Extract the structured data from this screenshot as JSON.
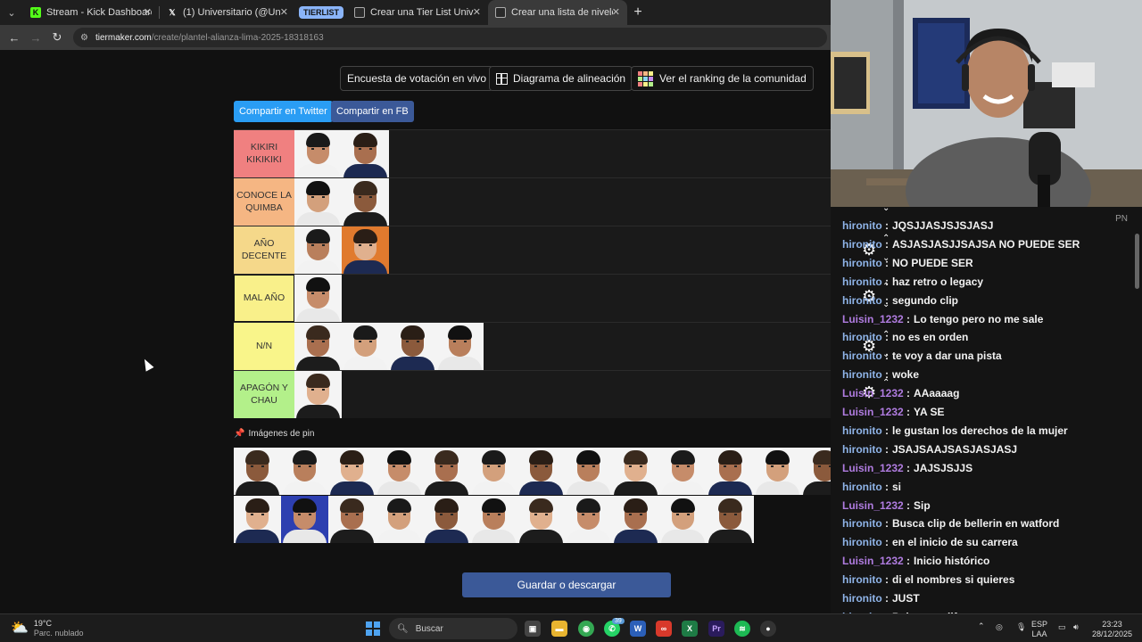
{
  "browser": {
    "tabs": [
      {
        "label": "Stream - Kick Dashboard",
        "favicon": "kick-logo-icon",
        "active": false
      },
      {
        "label": "(1) Universitario (@Universitario",
        "favicon": "x-logo-icon",
        "active": false
      },
      {
        "label": "Crear una Tier List Universitario",
        "favicon": "tiermaker-icon",
        "active": false
      },
      {
        "label": "Crear una lista de niveles de Al",
        "favicon": "tiermaker-icon",
        "active": true
      }
    ],
    "tab_group_label": "TIERLIST",
    "url_host": "tiermaker.com",
    "url_path": "/create/plantel-alianza-lima-2025-18318163"
  },
  "page": {
    "buttons": {
      "live_poll": "Encuesta de votación en vivo",
      "lineup": "Diagrama de alineación",
      "community": "Ver el ranking de la comunidad",
      "twitter": "Compartir en Twitter",
      "facebook": "Compartir en FB",
      "save": "Guardar o descargar"
    },
    "tiers": [
      {
        "label": "KIKIRI KIKIKIKI",
        "color": "#f08080",
        "players": 2
      },
      {
        "label": "CONOCE LA QUIMBA",
        "color": "#f5b683",
        "players": 2
      },
      {
        "label": "AÑO DECENTE",
        "color": "#f5d88a",
        "players": 2
      },
      {
        "label": "MAL AÑO",
        "color": "#f9f08a",
        "players": 1
      },
      {
        "label": "N/N",
        "color": "#f9f58a",
        "players": 4
      },
      {
        "label": "APAGÓN Y CHAU",
        "color": "#b3f08a",
        "players": 1
      }
    ],
    "pinned_title": "Imágenes de pin",
    "pool_players": 25
  },
  "chat": {
    "pn_label": "PN",
    "messages": [
      {
        "user": "hironito",
        "text": "JQSJJASJSJSJASJ",
        "color": "#8fb4e8"
      },
      {
        "user": "hironito",
        "text": "ASJASJASJJSAJSA NO PUEDE SER",
        "color": "#8fb4e8"
      },
      {
        "user": "hironito",
        "text": "NO PUEDE SER",
        "color": "#8fb4e8"
      },
      {
        "user": "hironito",
        "text": "haz retro o legacy",
        "color": "#8fb4e8"
      },
      {
        "user": "hironito",
        "text": "segundo clip",
        "color": "#8fb4e8"
      },
      {
        "user": "Luisin_1232",
        "text": "Lo tengo pero no me sale",
        "color": "#b07ce0"
      },
      {
        "user": "hironito",
        "text": "no es en orden",
        "color": "#8fb4e8"
      },
      {
        "user": "hironito",
        "text": "te voy a dar una pista",
        "color": "#8fb4e8"
      },
      {
        "user": "hironito",
        "text": "woke",
        "color": "#8fb4e8"
      },
      {
        "user": "Luisin_1232",
        "text": "AAaaaag",
        "color": "#b07ce0"
      },
      {
        "user": "Luisin_1232",
        "text": "YA SE",
        "color": "#b07ce0"
      },
      {
        "user": "hironito",
        "text": "le gustan los derechos de la mujer",
        "color": "#8fb4e8"
      },
      {
        "user": "hironito",
        "text": "JSAJSAAJSASJASJASJ",
        "color": "#8fb4e8"
      },
      {
        "user": "Luisin_1232",
        "text": "JAJSJSJJS",
        "color": "#b07ce0"
      },
      {
        "user": "hironito",
        "text": "si",
        "color": "#8fb4e8"
      },
      {
        "user": "Luisin_1232",
        "text": "Sip",
        "color": "#b07ce0"
      },
      {
        "user": "hironito",
        "text": "Busca clip de bellerin en watford",
        "color": "#8fb4e8"
      },
      {
        "user": "hironito",
        "text": "en el inicio de su carrera",
        "color": "#8fb4e8"
      },
      {
        "user": "Luisin_1232",
        "text": "Inicio histórico",
        "color": "#b07ce0"
      },
      {
        "user": "hironito",
        "text": "di el nombres si quieres",
        "color": "#8fb4e8"
      },
      {
        "user": "hironito",
        "text": "JUST",
        "color": "#8fb4e8"
      },
      {
        "user": "hironito",
        "text": "Pobres audifonos",
        "color": "#8fb4e8"
      }
    ]
  },
  "taskbar": {
    "temperature": "19°C",
    "weather": "Parc. nublado",
    "search_placeholder": "Buscar",
    "lang_top": "ESP",
    "lang_bottom": "LAA",
    "time": "23:23",
    "date": "28/12/2025",
    "badge_count": "39"
  }
}
